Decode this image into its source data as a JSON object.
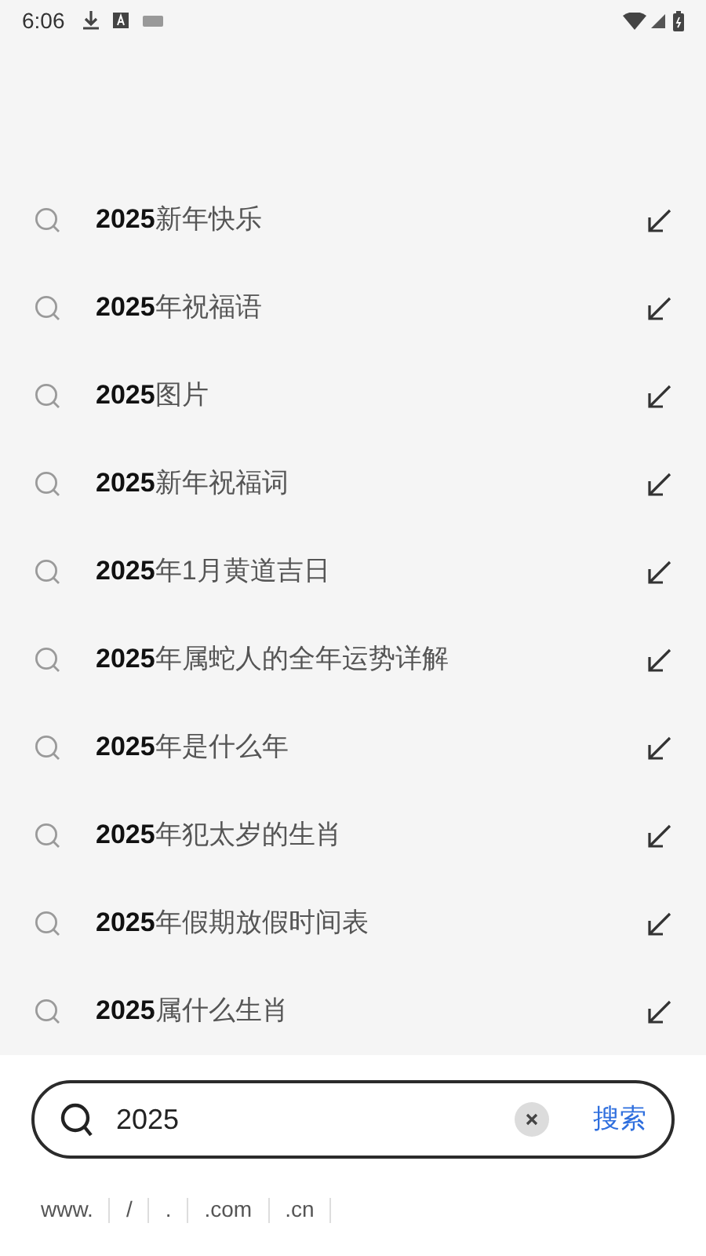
{
  "status_bar": {
    "time": "6:06"
  },
  "suggestions": [
    {
      "text": "**2025**新年快乐"
    },
    {
      "text": "**2025**年祝福语"
    },
    {
      "text": "**2025**图片"
    },
    {
      "text": "**2025**新年祝福词"
    },
    {
      "text": "**2025**年1月黄道吉日"
    },
    {
      "text": "**2025**年属蛇人的全年运势详解"
    },
    {
      "text": "**2025**年是什么年"
    },
    {
      "text": "**2025**年犯太岁的生肖"
    },
    {
      "text": "**2025**年假期放假时间表"
    },
    {
      "text": "**2025**属什么生肖"
    }
  ],
  "search": {
    "value": "2025",
    "button": "搜索"
  },
  "shortcuts": [
    "www.",
    "/",
    ".",
    ".com",
    ".cn"
  ]
}
